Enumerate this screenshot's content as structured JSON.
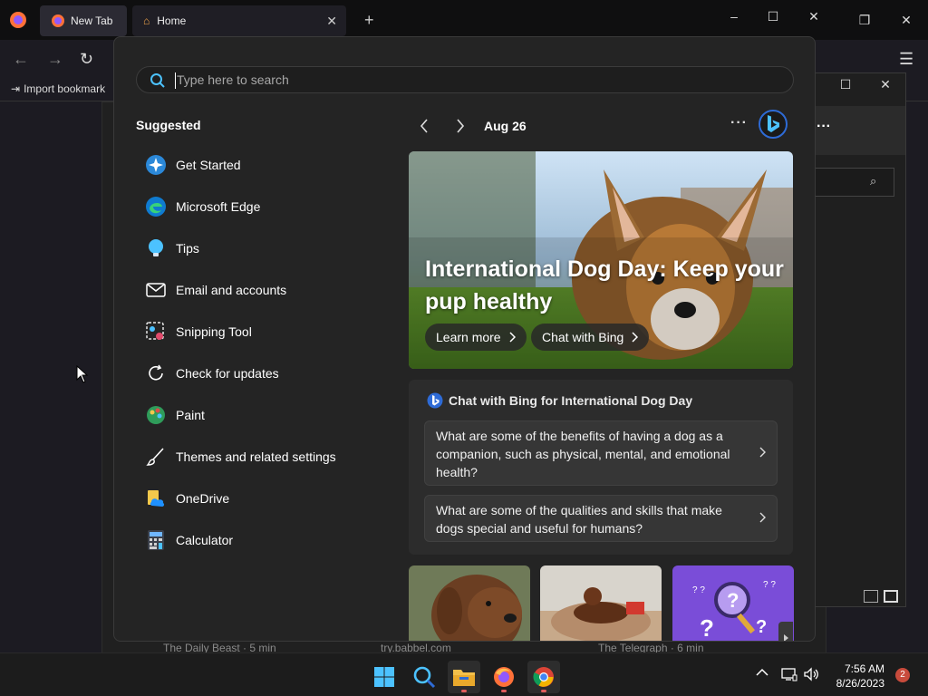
{
  "firefox": {
    "tabs": [
      {
        "label": "New Tab"
      },
      {
        "label": "Home"
      }
    ],
    "bookmark_label": "Import bookmark"
  },
  "background_text": {
    "a": "The Daily Beast · 5 min",
    "b": "try.babbel.com",
    "c": "The Telegraph · 6 min"
  },
  "start_menu": {
    "search_placeholder": "Type here to search",
    "suggested_title": "Suggested",
    "suggested": [
      {
        "label": "Get Started",
        "icon": "get-started-icon"
      },
      {
        "label": "Microsoft Edge",
        "icon": "edge-icon"
      },
      {
        "label": "Tips",
        "icon": "tips-icon"
      },
      {
        "label": "Email and accounts",
        "icon": "mail-icon"
      },
      {
        "label": "Snipping Tool",
        "icon": "snipping-tool-icon"
      },
      {
        "label": "Check for updates",
        "icon": "refresh-icon"
      },
      {
        "label": "Paint",
        "icon": "paint-icon"
      },
      {
        "label": "Themes and related settings",
        "icon": "brush-icon"
      },
      {
        "label": "OneDrive",
        "icon": "onedrive-icon"
      },
      {
        "label": "Calculator",
        "icon": "calculator-icon"
      }
    ],
    "date": "Aug 26",
    "hero": {
      "title": "International Dog Day: Keep your pup healthy",
      "learn_more": "Learn more",
      "chat_with_bing": "Chat with Bing"
    },
    "chat_card": {
      "title": "Chat with Bing for International Dog Day",
      "questions": [
        "What are some of the benefits of having a dog as a companion, such as physical, mental, and emotional health?",
        "What are some of the qualities and skills that make dogs special and useful for humans?"
      ]
    }
  },
  "taskbar": {
    "time": "7:56 AM",
    "date": "8/26/2023",
    "notifications": "2"
  },
  "colors": {
    "accent": "#2e6bd6",
    "start_bg": "#242424",
    "taskbar_bg": "#1c1c1c"
  }
}
